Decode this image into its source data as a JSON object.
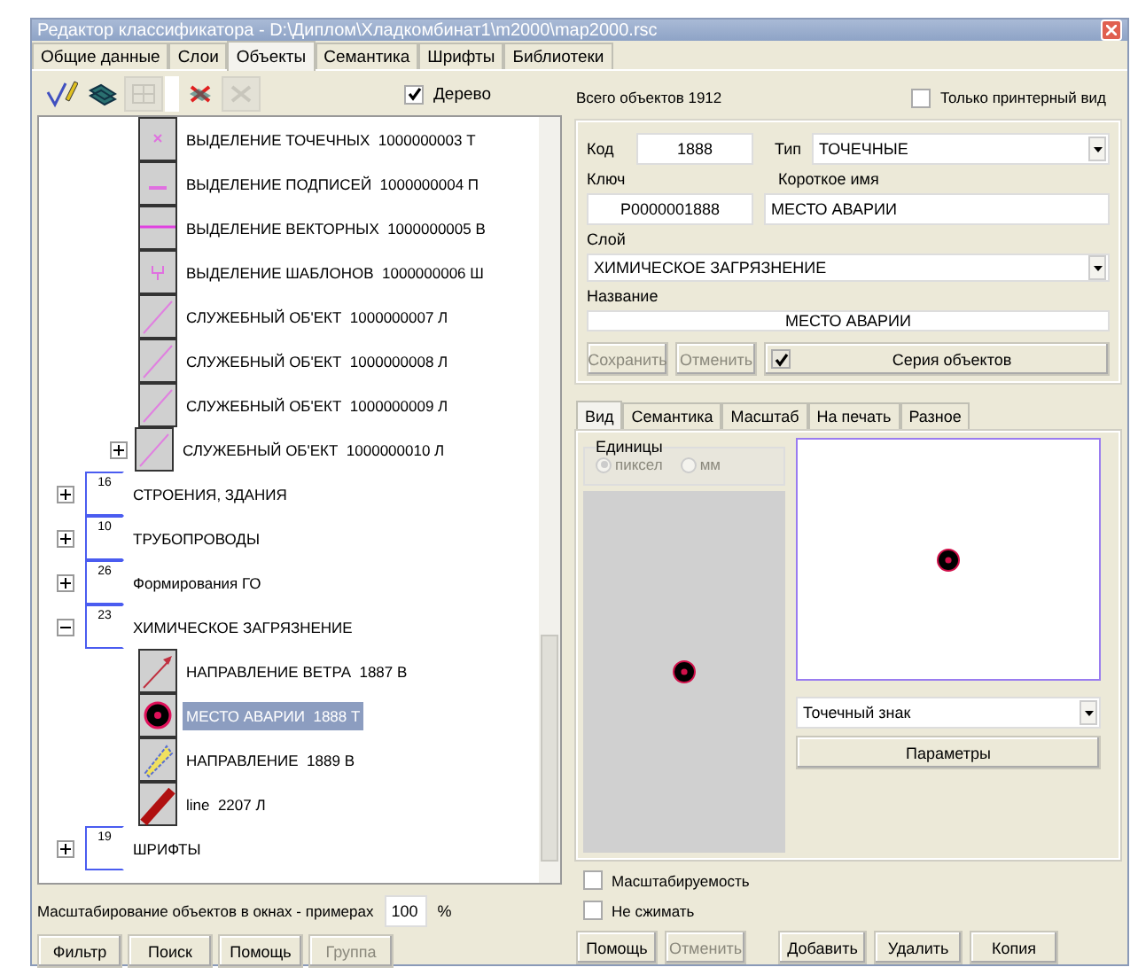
{
  "window": {
    "title": "Редактор классификатора - D:\\Диплом\\Хладкомбинат1\\m2000\\map2000.rsc"
  },
  "tabs": [
    {
      "label": "Общие данные",
      "selected": false
    },
    {
      "label": "Слои",
      "selected": false
    },
    {
      "label": "Объекты",
      "selected": true
    },
    {
      "label": "Семантика",
      "selected": false
    },
    {
      "label": "Шрифты",
      "selected": false
    },
    {
      "label": "Библиотеки",
      "selected": false
    }
  ],
  "toolbar": {
    "buttons": [
      {
        "kind": "pen",
        "disabled": false
      },
      {
        "kind": "stack",
        "disabled": false
      },
      {
        "kind": "grid",
        "disabled": true
      },
      {
        "kind": "cross",
        "disabled": false
      },
      {
        "kind": "cross",
        "disabled": true
      }
    ],
    "tree_checkbox": {
      "label": "Дерево",
      "checked": true
    }
  },
  "tree": {
    "scrolled_items": [
      {
        "kind": "point-mark",
        "label": "ВЫДЕЛЕНИЕ ТОЧЕЧНЫХ  1000000003 Т",
        "selected": false,
        "expandable": false
      },
      {
        "kind": "label-mark",
        "label": "ВЫДЕЛЕНИЕ ПОДПИСЕЙ  1000000004 П",
        "selected": false,
        "expandable": false
      },
      {
        "kind": "line-mark",
        "label": "ВЫДЕЛЕНИЕ ВЕКТОРНЫХ  1000000005 В",
        "selected": false,
        "expandable": false
      },
      {
        "kind": "template-mark",
        "label": "ВЫДЕЛЕНИЕ ШАБЛОНОВ  1000000006 Ш",
        "selected": false,
        "expandable": false
      },
      {
        "kind": "diagonal",
        "label": "СЛУЖЕБНЫЙ ОБ'ЕКТ  1000000007 Л",
        "selected": false,
        "expandable": false
      },
      {
        "kind": "diagonal",
        "label": "СЛУЖЕБНЫЙ ОБ'ЕКТ  1000000008 Л",
        "selected": false,
        "expandable": false
      },
      {
        "kind": "diagonal",
        "label": "СЛУЖЕБНЫЙ ОБ'ЕКТ  1000000009 Л",
        "selected": false,
        "expandable": false
      },
      {
        "kind": "diagonal",
        "label": "СЛУЖЕБНЫЙ ОБ'ЕКТ  1000000010 Л",
        "selected": false,
        "expandable": true
      }
    ],
    "groups": [
      {
        "number": "16",
        "label": "СТРОЕНИЯ, ЗДАНИЯ",
        "expanded": false
      },
      {
        "number": "10",
        "label": "ТРУБОПРОВОДЫ",
        "expanded": false
      },
      {
        "number": "26",
        "label": "Формирования ГО",
        "expanded": false
      },
      {
        "number": "23",
        "label": "ХИМИЧЕСКОЕ ЗАГРЯЗНЕНИЕ",
        "expanded": true,
        "children": [
          {
            "kind": "arrow",
            "label": "НАПРАВЛЕНИЕ ВЕТРА  1887 В",
            "selected": false,
            "expandable": false
          },
          {
            "kind": "disc",
            "label": "МЕСТО АВАРИИ  1888 Т",
            "selected": true,
            "expandable": false
          },
          {
            "kind": "fan",
            "label": "НАПРАВЛЕНИЕ  1889 В",
            "selected": false,
            "expandable": false
          },
          {
            "kind": "bar",
            "label": "line  2207 Л",
            "selected": false,
            "expandable": false
          }
        ]
      },
      {
        "number": "19",
        "label": "ШРИФТЫ",
        "expanded": false
      }
    ]
  },
  "scale": {
    "label": "Масштабирование объектов в окнах - примерах",
    "value": "100",
    "unit": "%"
  },
  "left_buttons": [
    {
      "label": "Фильтр",
      "disabled": false
    },
    {
      "label": "Поиск",
      "disabled": false
    },
    {
      "label": "Помощь",
      "disabled": false
    },
    {
      "label": "Группа",
      "disabled": true
    }
  ],
  "total": {
    "label": "Всего объектов",
    "value": "1912"
  },
  "printer_only": {
    "label": "Только принтерный вид",
    "checked": false
  },
  "form": {
    "code_label": "Код",
    "code": "1888",
    "type_label": "Тип",
    "type": "ТОЧЕЧНЫЕ",
    "key_label": "Ключ",
    "key": "P0000001888",
    "short_label": "Короткое имя",
    "short_name": "МЕСТО АВАРИИ",
    "layer_label": "Слой",
    "layer": "ХИМИЧЕСКОЕ ЗАГРЯЗНЕНИЕ",
    "name_label": "Название",
    "name": "МЕСТО АВАРИИ",
    "buttons": [
      {
        "label": "Сохранить",
        "disabled": true
      },
      {
        "label": "Отменить",
        "disabled": true
      }
    ],
    "series": {
      "label": "Серия объектов",
      "checked": true
    }
  },
  "view_tabs": [
    {
      "label": "Вид",
      "selected": true
    },
    {
      "label": "Семантика",
      "selected": false
    },
    {
      "label": "Масштаб",
      "selected": false
    },
    {
      "label": "На печать",
      "selected": false
    },
    {
      "label": "Разное",
      "selected": false
    }
  ],
  "units": {
    "title": "Единицы",
    "options": [
      {
        "label": "пиксел",
        "selected": true
      },
      {
        "label": "мм",
        "selected": false
      }
    ],
    "disabled": true
  },
  "sign_type": "Точечный знак",
  "params_button": "Параметры",
  "options": [
    {
      "label": "Масштабируемость",
      "checked": false
    },
    {
      "label": "Не сжимать",
      "checked": false
    }
  ],
  "bottom_buttons": [
    {
      "label": "Помощь",
      "disabled": false
    },
    {
      "label": "Отменить",
      "disabled": true
    },
    {
      "label": "Добавить",
      "disabled": false
    },
    {
      "label": "Удалить",
      "disabled": false
    },
    {
      "label": "Копия",
      "disabled": false
    }
  ]
}
